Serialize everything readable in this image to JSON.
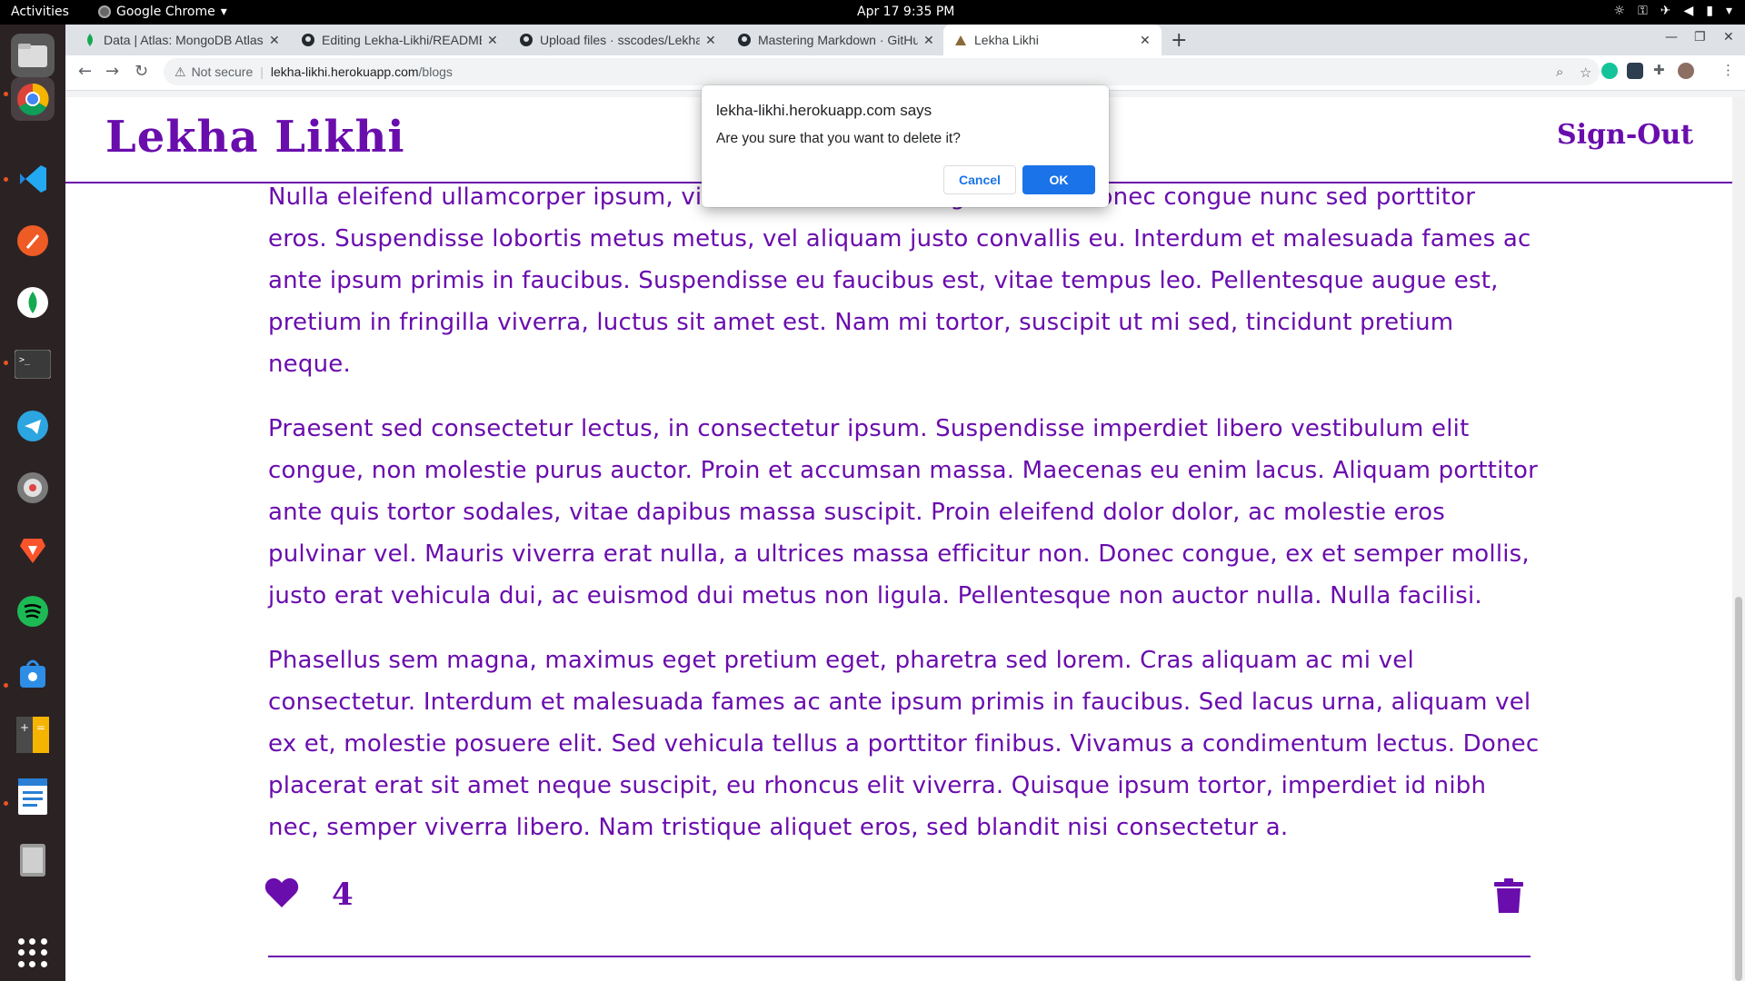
{
  "topbar": {
    "activities": "Activities",
    "app_menu": "Google Chrome",
    "clock": "Apr 17  9:35 PM"
  },
  "dock": {
    "items": [
      "files-icon",
      "chrome-icon",
      "vscode-icon",
      "postman-icon",
      "mongodb-compass-icon",
      "terminal-icon",
      "telegram-icon",
      "app-icon",
      "brave-icon",
      "spotify-icon",
      "software-center-icon",
      "calculator-icon",
      "writer-icon",
      "trash-app-icon",
      "show-apps-icon"
    ]
  },
  "browser": {
    "tabs": [
      {
        "title": "Data | Atlas: MongoDB Atlas",
        "icon": "mongodb-leaf-icon"
      },
      {
        "title": "Editing Lekha-Likhi/README",
        "icon": "github-icon"
      },
      {
        "title": "Upload files · sscodes/Lekha",
        "icon": "github-icon"
      },
      {
        "title": "Mastering Markdown · GitHub",
        "icon": "github-icon"
      },
      {
        "title": "Lekha Likhi",
        "icon": "site-icon",
        "active": true
      }
    ],
    "security_label": "Not secure",
    "url_host": "lekha-likhi.herokuapp.com",
    "url_path": "/blogs"
  },
  "site": {
    "brand": "Lekha Likhi",
    "signout": "Sign-Out",
    "paragraphs": [
      "Nulla eleifend ullamcorper ipsum, vitae euismod lacus dignissim a. Donec congue nunc sed porttitor eros. Suspendisse lobortis metus metus, vel aliquam justo convallis eu. Interdum et malesuada fames ac ante ipsum primis in faucibus. Suspendisse eu faucibus est, vitae tempus leo. Pellentesque augue est, pretium in fringilla viverra, luctus sit amet est. Nam mi tortor, suscipit ut mi sed, tincidunt pretium neque.",
      "Praesent sed consectetur lectus, in consectetur ipsum. Suspendisse imperdiet libero vestibulum elit congue, non molestie purus auctor. Proin et accumsan massa. Maecenas eu enim lacus. Aliquam porttitor ante quis tortor sodales, vitae dapibus massa suscipit. Proin eleifend dolor dolor, ac molestie eros pulvinar vel. Mauris viverra erat nulla, a ultrices massa efficitur non. Donec congue, ex et semper mollis, justo erat vehicula dui, ac euismod dui metus non ligula. Pellentesque non auctor nulla. Nulla facilisi.",
      "Phasellus sem magna, maximus eget pretium eget, pharetra sed lorem. Cras aliquam ac mi vel consectetur. Interdum et malesuada fames ac ante ipsum primis in faucibus. Sed lacus urna, aliquam vel ex et, molestie posuere elit. Sed vehicula tellus a porttitor finibus. Vivamus a condimentum lectus. Donec placerat erat sit amet neque suscipit, eu rhoncus elit viverra. Quisque ipsum tortor, imperdiet id nibh nec, semper viverra libero. Nam tristique aliquet eros, sed blandit nisi consectetur a."
    ],
    "like_count": "4",
    "accent_color": "#6a0dad"
  },
  "dialog": {
    "origin": "lekha-likhi.herokuapp.com says",
    "message": "Are you sure that you want to delete it?",
    "cancel_label": "Cancel",
    "ok_label": "OK"
  }
}
